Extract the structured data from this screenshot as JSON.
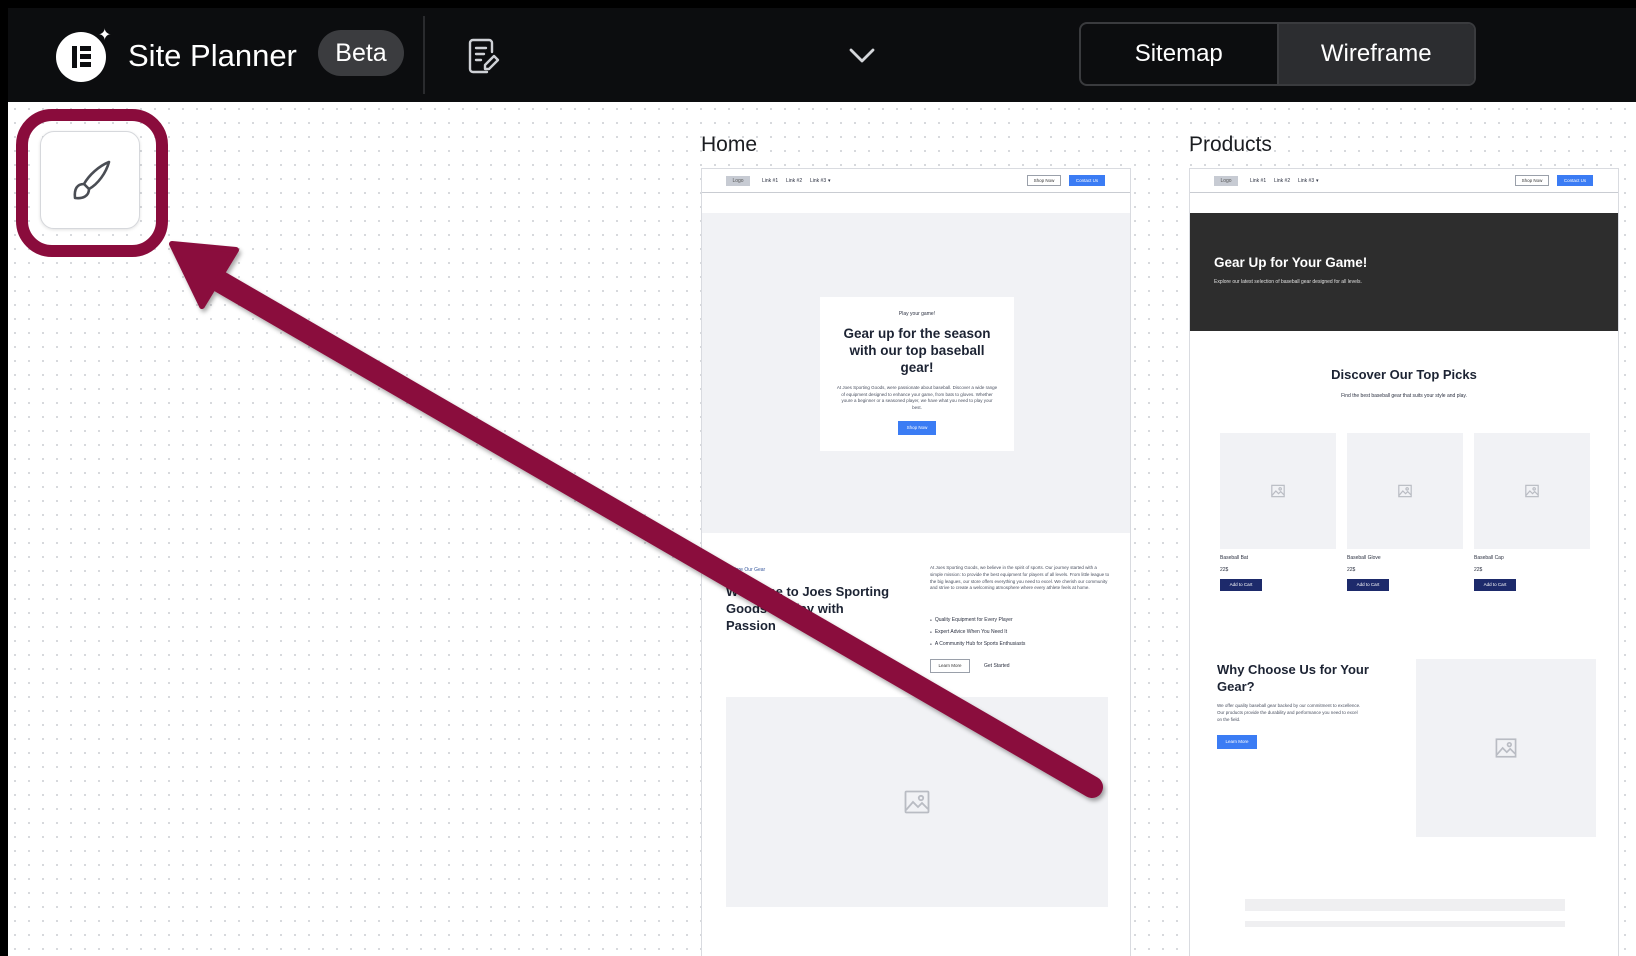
{
  "app": {
    "title": "Site Planner",
    "badge": "Beta",
    "icons": [
      "elementor-logo-icon",
      "sparkle-icon",
      "page-edit-icon",
      "chevron-down-icon",
      "brush-icon",
      "image-placeholder-icon"
    ]
  },
  "view_toggle": {
    "options": [
      {
        "label": "Sitemap",
        "active": false
      },
      {
        "label": "Wireframe",
        "active": true
      }
    ]
  },
  "colors": {
    "topbar": "#0c0d0f",
    "highlight": "#8a0c3c",
    "wireframe_accent": "#3b7cf4",
    "wireframe_navy": "#1d2a6b",
    "dark_banner": "#2d2d2d"
  },
  "pages": {
    "home": {
      "label": "Home",
      "nav": {
        "logo": "Logo",
        "links": [
          "Link #1",
          "Link #2",
          "Link #3"
        ],
        "shop_btn": "Shop Now",
        "contact_btn": "Contact Us"
      },
      "hero": {
        "eyebrow": "Play your game!",
        "heading": "Gear up for the season with our top baseball gear!",
        "body": "At Joes Sporting Goods, were passionate about baseball. Discover a wide range of equipment designed to enhance your game, from bats to gloves. Whether youre a beginner or a seasoned player, we have what you need to play your best.",
        "cta": "Shop Now"
      },
      "about": {
        "eyebrow": "Explore Our Gear",
        "heading": "Welcome to Joes Sporting Goods — Play with Passion",
        "body": "At Joes Sporting Goods, we believe in the spirit of sports. Our journey started with a simple mission: to provide the best equipment for players of all levels. From little league to the big leagues, our store offers everything you need to excel. We cherish our community and strive to create a welcoming atmosphere where every athlete feels at home.",
        "bullets": [
          "Quality Equipment for Every Player",
          "Expert Advice When You Need It",
          "A Community Hub for Sports Enthusiasts"
        ],
        "btn_primary": "Learn More",
        "btn_secondary": "Get Started"
      }
    },
    "products": {
      "label": "Products",
      "nav": {
        "logo": "Logo",
        "links": [
          "Link #1",
          "Link #2",
          "Link #3"
        ],
        "shop_btn": "Shop Now",
        "contact_btn": "Contact Us"
      },
      "banner": {
        "heading": "Gear Up for Your Game!",
        "body": "Explore our latest selection of baseball gear designed for all levels."
      },
      "picks": {
        "heading": "Discover Our Top Picks",
        "body": "Find the best baseball gear that suits your style and play.",
        "products": [
          {
            "name": "Baseball Bat",
            "price": "22$",
            "btn": "Add to Cart"
          },
          {
            "name": "Baseball Glove",
            "price": "22$",
            "btn": "Add to Cart"
          },
          {
            "name": "Baseball Cap",
            "price": "22$",
            "btn": "Add to Cart"
          }
        ]
      },
      "why": {
        "heading": "Why Choose Us for Your Gear?",
        "body": "We offer quality baseball gear backed by our commitment to excellence. Our products provide the durability and performance you need to excel on the field.",
        "btn": "Learn More"
      }
    }
  }
}
